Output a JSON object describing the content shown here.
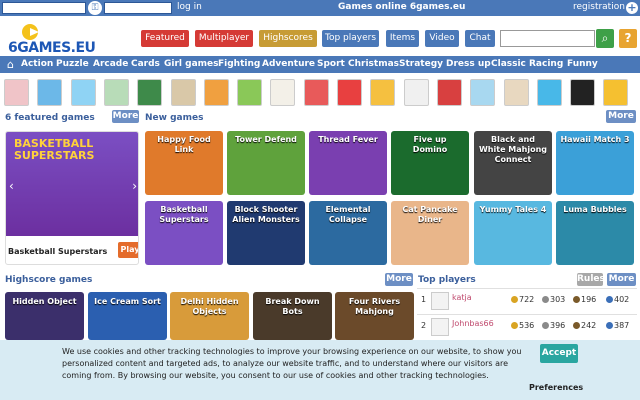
{
  "topbar": {
    "login": "log in",
    "site_title": "Games online 6games.eu",
    "registration": "registration"
  },
  "logo": {
    "text": "6GAMES.EU"
  },
  "main_buttons": [
    {
      "label": "Featured",
      "color": "#d53a35"
    },
    {
      "label": "Multiplayer",
      "color": "#d53a35"
    },
    {
      "label": "Highscores",
      "color": "#c79c35"
    },
    {
      "label": "Top players",
      "color": "#4a78b8"
    },
    {
      "label": "Items",
      "color": "#4a78b8"
    },
    {
      "label": "Video",
      "color": "#4a78b8"
    },
    {
      "label": "Chat",
      "color": "#4a78b8"
    }
  ],
  "search": {
    "placeholder": ""
  },
  "help_label": "?",
  "categories": [
    "Action",
    "Puzzle",
    "Arcade",
    "Cards",
    "Girl games",
    "Fighting",
    "Adventure",
    "Sport",
    "Christmas",
    "Strategy",
    "Dress up",
    "Classic",
    "Racing",
    "Funny"
  ],
  "sections": {
    "featured": "6 featured games",
    "new": "New games",
    "highscore": "Highscore games",
    "top_players": "Top players",
    "more": "More",
    "rules": "Rules"
  },
  "featured": {
    "title": "BASKETBALL SUPERSTARS",
    "name": "Basketball Superstars",
    "play": "Play"
  },
  "new_games": [
    {
      "label": "Happy Food Link",
      "color": "#e07a2b"
    },
    {
      "label": "Tower Defend",
      "color": "#5fa23c"
    },
    {
      "label": "Thread Fever",
      "color": "#7a3fb0"
    },
    {
      "label": "Five up Domino",
      "color": "#1b6b2d"
    },
    {
      "label": "Black and White Mahjong Connect",
      "color": "#444"
    },
    {
      "label": "Hawaii Match 3",
      "color": "#3ba0d8"
    },
    {
      "label": "Basketball Superstars",
      "color": "#7b4fc3"
    },
    {
      "label": "Block Shooter Alien Monsters",
      "color": "#203a70"
    },
    {
      "label": "Elemental Collapse",
      "color": "#2c6aa0"
    },
    {
      "label": "Cat Pancake Diner",
      "color": "#e9b68a"
    },
    {
      "label": "Yummy Tales 4",
      "color": "#58b8e0"
    },
    {
      "label": "Luma Bubbles",
      "color": "#2c8aa8"
    }
  ],
  "highscore_games": [
    {
      "label": "Hidden Object",
      "color": "#3b2f6b"
    },
    {
      "label": "Ice Cream Sort",
      "color": "#2b5fb0"
    },
    {
      "label": "Delhi Hidden Objects",
      "color": "#d89b3a"
    },
    {
      "label": "Break Down Bots",
      "color": "#4a3a2a"
    },
    {
      "label": "Four Rivers Mahjong",
      "color": "#6b4a2a"
    }
  ],
  "top_players": [
    {
      "rank": "1",
      "name": "katja",
      "s1": "722",
      "s2": "303",
      "s3": "196",
      "s4": "402"
    },
    {
      "rank": "2",
      "name": "Johnbas66",
      "s1": "536",
      "s2": "396",
      "s3": "242",
      "s4": "387"
    }
  ],
  "cookie": {
    "message": "We use cookies and other tracking technologies to improve your browsing experience on our website, to show you personalized content and targeted ads, to analyze our website traffic, and to understand where our visitors are coming from. By browsing our website, you consent to our use of cookies and other tracking technologies.",
    "accept": "Accept",
    "preferences": "Preferences"
  }
}
